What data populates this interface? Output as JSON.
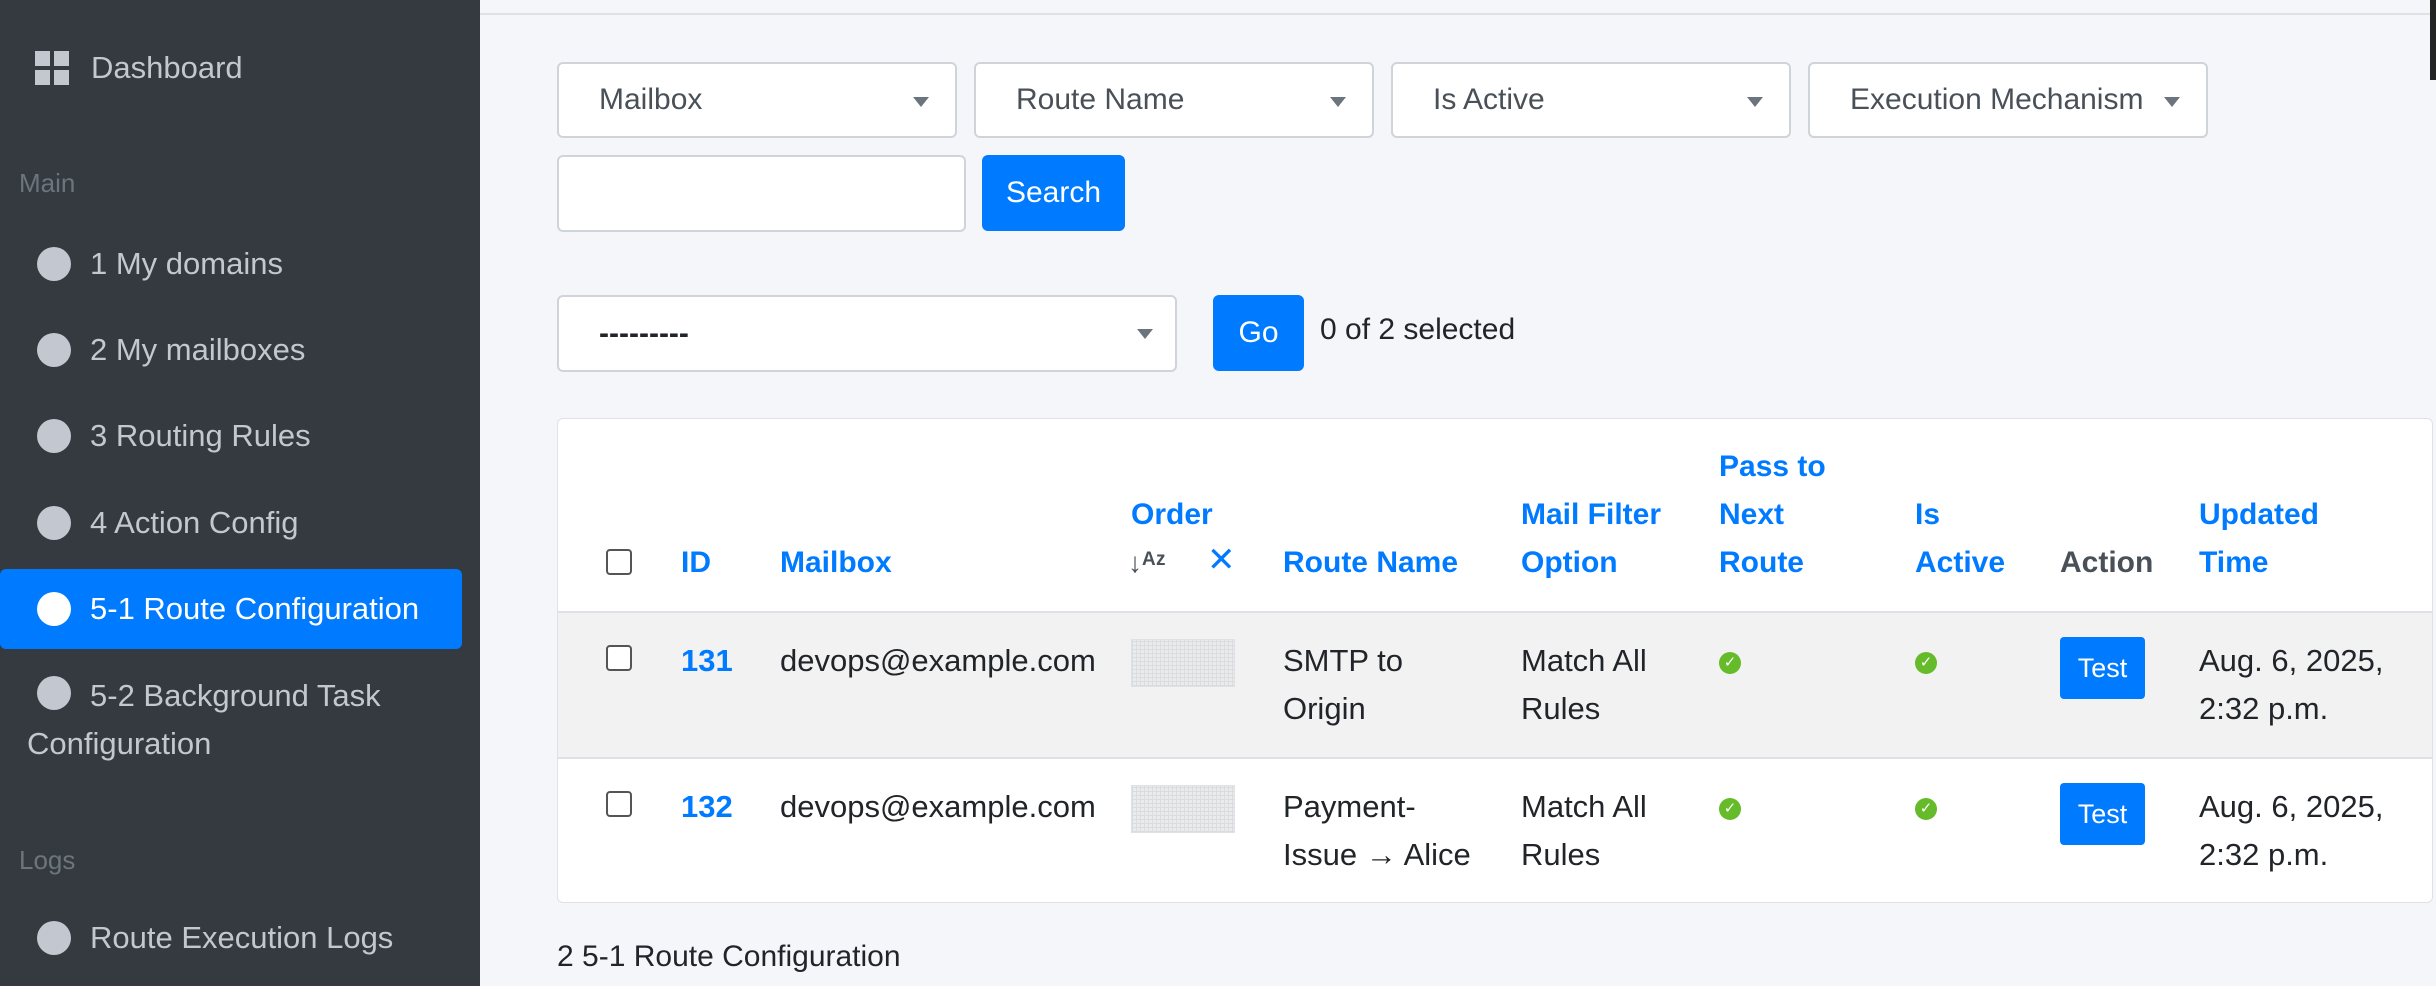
{
  "sidebar": {
    "dashboard": "Dashboard",
    "section_main": "Main",
    "items": [
      {
        "label": "1 My domains"
      },
      {
        "label": "2 My mailboxes"
      },
      {
        "label": "3 Routing Rules"
      },
      {
        "label": "4 Action Config"
      },
      {
        "label": "5-1 Route Configuration"
      },
      {
        "label_line1": "5-2 Background Task",
        "label_line2": "Configuration"
      }
    ],
    "section_logs": "Logs",
    "logs_items": [
      {
        "label": "Route Execution Logs"
      }
    ]
  },
  "filters": {
    "mailbox": "Mailbox",
    "route_name": "Route Name",
    "is_active": "Is Active",
    "execution_mechanism": "Execution Mechanism",
    "search_value": "",
    "search_button": "Search"
  },
  "actions": {
    "select_value": "---------",
    "go_button": "Go",
    "selected_text": "0 of 2 selected"
  },
  "table": {
    "headers": {
      "id": "ID",
      "mailbox": "Mailbox",
      "order": "Order",
      "route_name": "Route Name",
      "mail_filter_1": "Mail Filter",
      "mail_filter_2": "Option",
      "pass_1": "Pass to",
      "pass_2": "Next",
      "pass_3": "Route",
      "active_1": "Is",
      "active_2": "Active",
      "action": "Action",
      "updated_1": "Updated",
      "updated_2": "Time"
    },
    "rows": [
      {
        "id": "131",
        "mailbox": "devops@example.com",
        "route_name_1": "SMTP to",
        "route_name_2": "Origin",
        "filter_1": "Match All",
        "filter_2": "Rules",
        "pass_next": true,
        "is_active": true,
        "action": "Test",
        "updated_1": "Aug. 6, 2025,",
        "updated_2": "2:32 p.m."
      },
      {
        "id": "132",
        "mailbox": "devops@example.com",
        "route_name_1": "Payment-",
        "route_name_2": "Issue → Alice",
        "filter_1": "Match All",
        "filter_2": "Rules",
        "pass_next": true,
        "is_active": true,
        "action": "Test",
        "updated_1": "Aug. 6, 2025,",
        "updated_2": "2:32 p.m."
      }
    ]
  },
  "footer": {
    "count_text": "2 5-1 Route Configuration"
  },
  "colors": {
    "primary": "#007bff",
    "sidebar_bg": "#343a40",
    "success": "#66bb2a"
  }
}
